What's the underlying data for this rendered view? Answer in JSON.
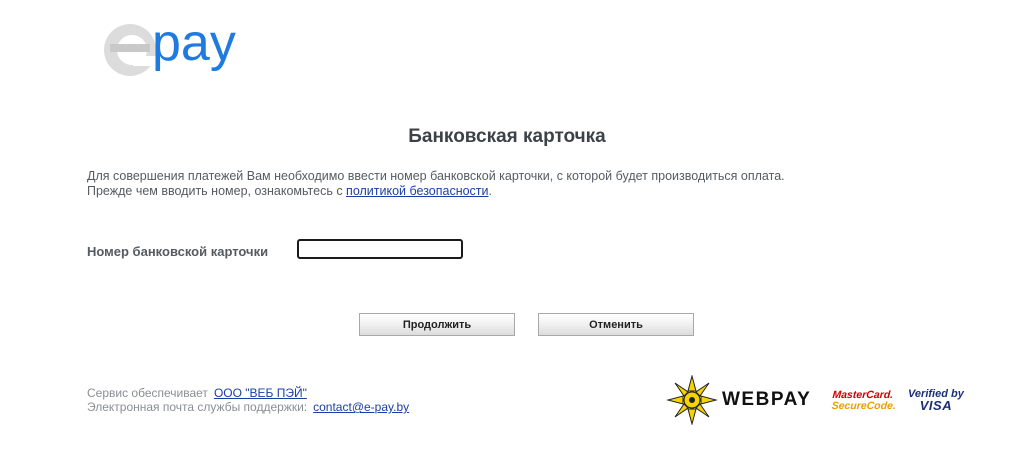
{
  "brand": {
    "logo_text": "epay",
    "logo_letter_e": "e",
    "logo_rest": "pay",
    "gray": "#dcdcdc",
    "blue": "#1f7be0"
  },
  "page": {
    "title": "Банковская карточка"
  },
  "intro": {
    "line1": "Для совершения платежей Вам необходимо ввести номер банковской карточки, с которой будет производиться оплата.",
    "line2_prefix": "Прежде чем вводить номер, ознакомьтесь с ",
    "line2_link": "политикой безопасности",
    "line2_suffix": "."
  },
  "form": {
    "card_label": "Номер банковской карточки",
    "card_value": "",
    "card_placeholder": ""
  },
  "buttons": {
    "continue": "Продолжить",
    "cancel": "Отменить"
  },
  "footer": {
    "service_label": "Сервис обеспечивает",
    "service_link": "ООО \"ВЕБ ПЭЙ\"",
    "support_label": "Электронная почта службы поддержки:",
    "support_email": "contact@e-pay.by"
  },
  "partners": {
    "webpay": "WEBPAY",
    "mastercard_line1": "MasterCard.",
    "mastercard_line2": "SecureCode.",
    "visa_line1": "Verified by",
    "visa_line2": "VISA"
  },
  "colors": {
    "link": "#1a3fa3",
    "text": "#555b61",
    "muted": "#8a8e93"
  }
}
